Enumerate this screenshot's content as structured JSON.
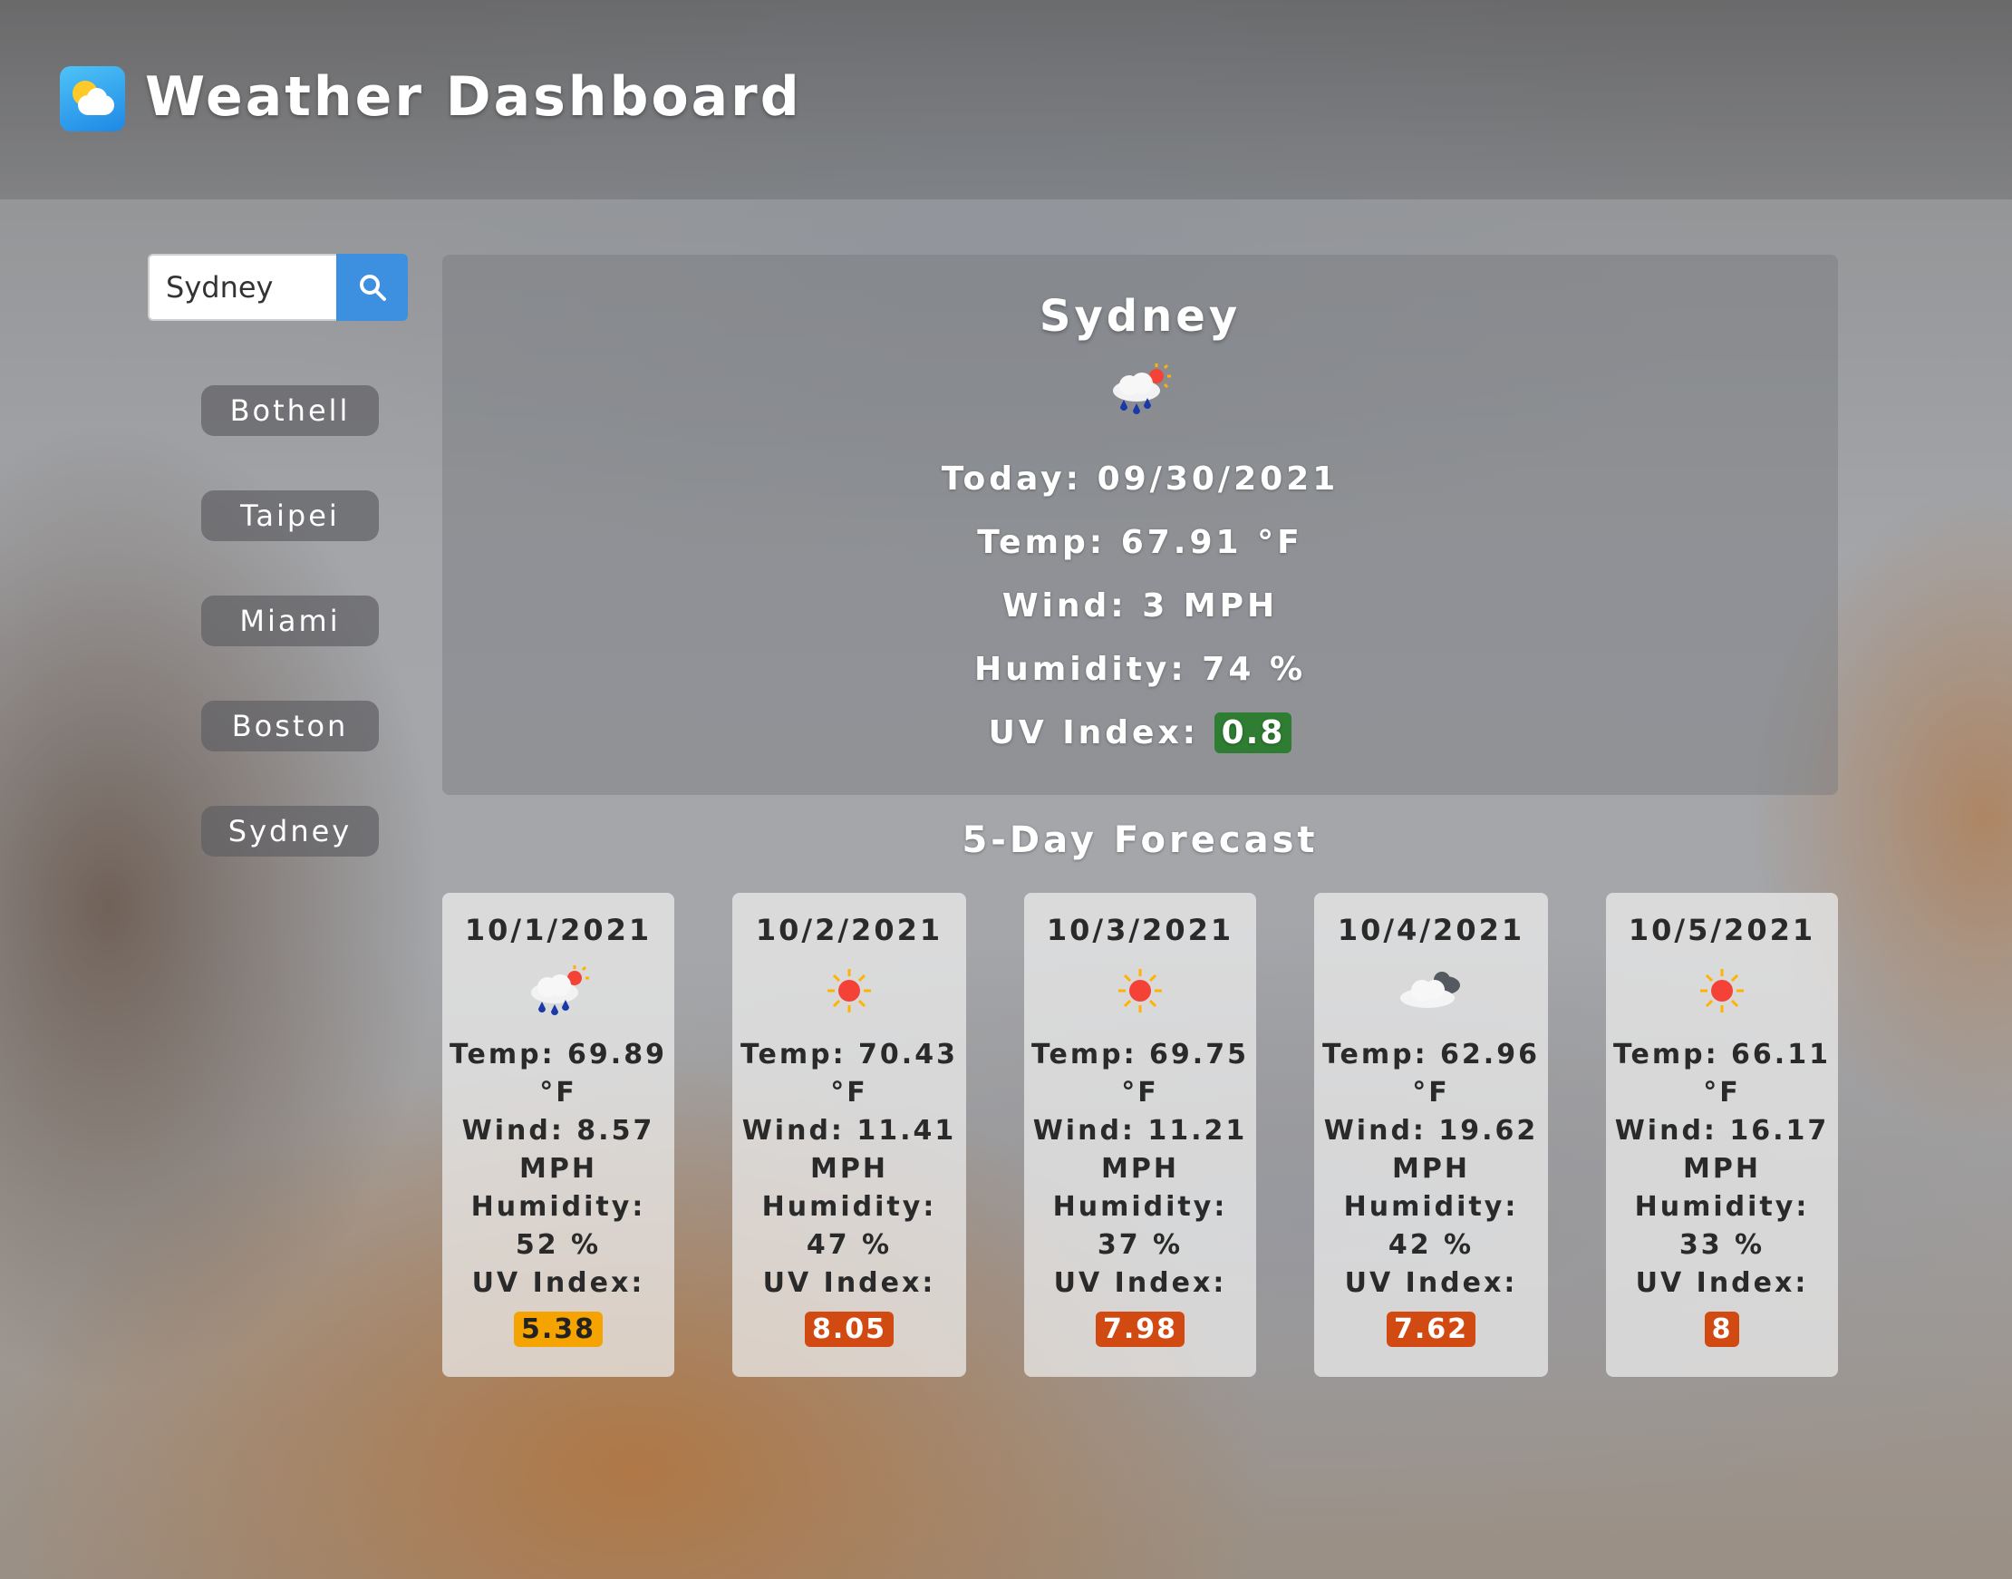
{
  "header": {
    "title": "Weather Dashboard",
    "icon": "partly-cloudy-app-icon"
  },
  "search": {
    "value": "Sydney",
    "placeholder": "",
    "button_icon": "search-icon"
  },
  "history": [
    "Bothell",
    "Taipei",
    "Miami",
    "Boston",
    "Sydney"
  ],
  "current": {
    "city": "Sydney",
    "icon": "rain-sun-icon",
    "date": "Today: 09/30/2021",
    "temp": "Temp: 67.91 °F",
    "wind": "Wind: 3 MPH",
    "humidity": "Humidity: 74 %",
    "uv_label": "UV Index:",
    "uv_value": "0.8",
    "uv_color": "#2e7d32"
  },
  "forecast_title": "5-Day Forecast",
  "forecast": [
    {
      "date": "10/1/2021",
      "icon": "rain-sun-icon",
      "temp": "Temp: 69.89",
      "temp_unit": "°F",
      "wind": "Wind: 8.57",
      "wind_unit": "MPH",
      "humidity_label": "Humidity:",
      "humidity": "52 %",
      "uv_label": "UV Index:",
      "uv": "5.38",
      "uv_color": "#f5a300",
      "uv_text_color": "#222222"
    },
    {
      "date": "10/2/2021",
      "icon": "sun-icon",
      "temp": "Temp: 70.43",
      "temp_unit": "°F",
      "wind": "Wind: 11.41",
      "wind_unit": "MPH",
      "humidity_label": "Humidity:",
      "humidity": "47 %",
      "uv_label": "UV Index:",
      "uv": "8.05",
      "uv_color": "#d04a12",
      "uv_text_color": "#ffffff"
    },
    {
      "date": "10/3/2021",
      "icon": "sun-icon",
      "temp": "Temp: 69.75",
      "temp_unit": "°F",
      "wind": "Wind: 11.21",
      "wind_unit": "MPH",
      "humidity_label": "Humidity:",
      "humidity": "37 %",
      "uv_label": "UV Index:",
      "uv": "7.98",
      "uv_color": "#d04a12",
      "uv_text_color": "#ffffff"
    },
    {
      "date": "10/4/2021",
      "icon": "cloud-icon",
      "temp": "Temp: 62.96",
      "temp_unit": "°F",
      "wind": "Wind: 19.62",
      "wind_unit": "MPH",
      "humidity_label": "Humidity:",
      "humidity": "42 %",
      "uv_label": "UV Index:",
      "uv": "7.62",
      "uv_color": "#d04a12",
      "uv_text_color": "#ffffff"
    },
    {
      "date": "10/5/2021",
      "icon": "sun-icon",
      "temp": "Temp: 66.11",
      "temp_unit": "°F",
      "wind": "Wind: 16.17",
      "wind_unit": "MPH",
      "humidity_label": "Humidity:",
      "humidity": "33 %",
      "uv_label": "UV Index:",
      "uv": "8",
      "uv_color": "#d04a12",
      "uv_text_color": "#ffffff"
    }
  ]
}
